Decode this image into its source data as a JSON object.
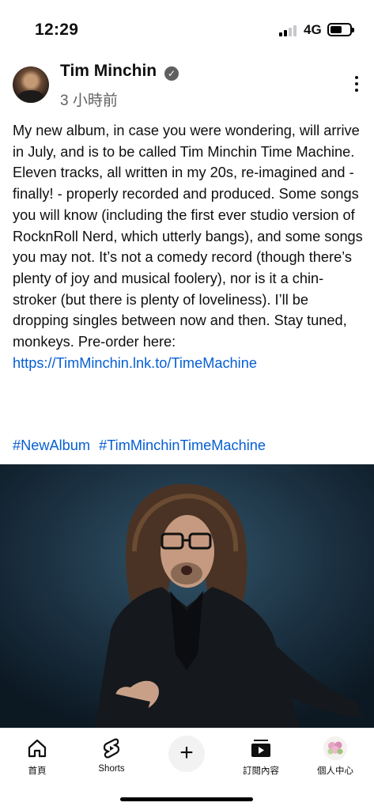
{
  "status_bar": {
    "time": "12:29",
    "network": "4G",
    "signal_bars_active": 2,
    "signal_bars_total": 4,
    "battery_level": 0.5
  },
  "post": {
    "channel_name": "Tim Minchin",
    "time_ago": "3 小時前",
    "text": "My new album, in case you were wondering, will arrive in July, and is to be called Tim Minchin Time Machine. Eleven tracks, all written in my 20s, re-imagined and - finally! - properly recorded and produced. Some songs you will know (including the first ever studio version of RocknRoll Nerd, which utterly bangs), and some songs you may not. It’s not a comedy record (though there’s plenty of joy and musical foolery), nor is it a chin-stroker (but there is plenty of loveliness). I’ll be dropping singles between now and then. Stay tuned, monkeys. Pre-order here: ",
    "link": "https://TimMinchin.lnk.to/TimeMachine",
    "hashtags": [
      "#NewAlbum",
      "#TimMinchinTimeMachine"
    ]
  },
  "bottom_nav": {
    "home": "首頁",
    "shorts": "Shorts",
    "subscriptions": "訂閱內容",
    "you": "個人中心"
  },
  "icons": {
    "verified": "check-badge-icon",
    "more": "kebab-icon",
    "home": "home-icon",
    "shorts": "shorts-icon",
    "create": "plus-icon",
    "subscriptions": "subscriptions-icon",
    "profile": "flower-avatar-icon"
  },
  "colors": {
    "link": "#065fd4",
    "secondary_text": "#606060"
  }
}
